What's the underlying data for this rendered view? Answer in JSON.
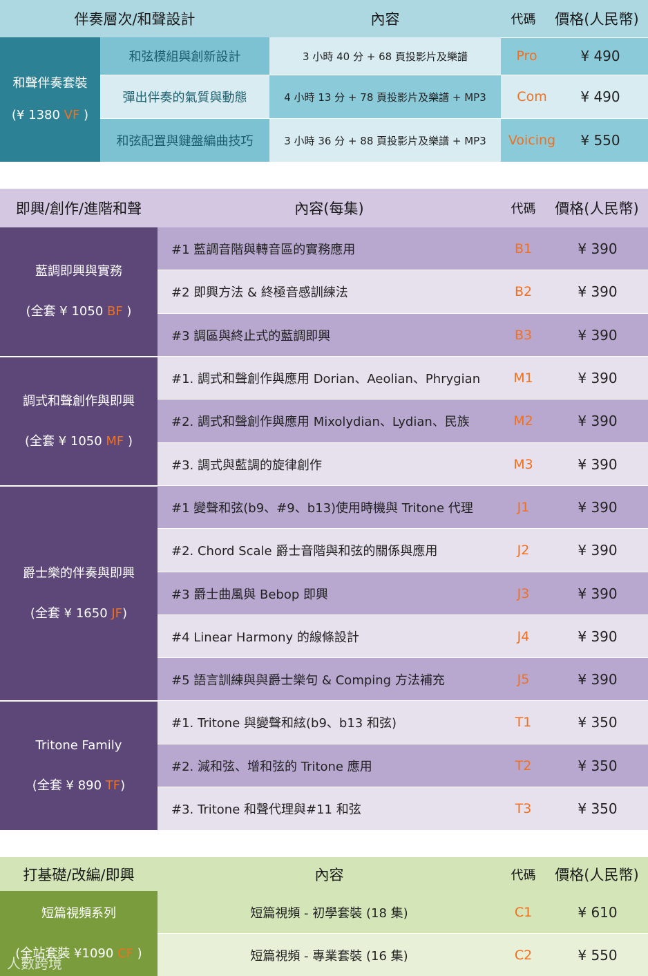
{
  "colors": {
    "sec1_header": "#aed8e1",
    "sec1_group": "#2c8294",
    "sec1_col1": "#7dc2d2",
    "sec1_row_light": "#d9ecf1",
    "sec1_row_mid": "#8bcad9",
    "sec2_header": "#d4c7e1",
    "sec2_group": "#5c4778",
    "sec2_row_dark": "#b8a8d0",
    "sec2_row_light": "#e7e1ee",
    "sec3_header": "#d3e4b7",
    "sec3_group": "#7a9c3c",
    "sec3_row_mid": "#d4e6b8",
    "sec3_row_light": "#e8f1d8",
    "code": "#f07020"
  },
  "sections": [
    {
      "header": {
        "title": "伴奏層次/和聲設計",
        "content": "內容",
        "code": "代碼",
        "price": "價格(人民幣)"
      },
      "groups": [
        {
          "name": "和聲伴奏套裝",
          "set_prefix": "(¥ 1380 ",
          "set_code": "VF",
          "set_suffix": " )",
          "rows": [
            {
              "title": "和弦模組與創新設計",
              "content": "3 小時 40 分 + 68 頁投影片及樂譜",
              "code": "Pro",
              "price": "¥ 490"
            },
            {
              "title": "彈出伴奏的氣質與動態",
              "content": "4 小時 13 分 + 78 頁投影片及樂譜 + MP3",
              "code": "Com",
              "price": "¥ 490"
            },
            {
              "title": "和弦配置與鍵盤編曲技巧",
              "content": "3 小時 36 分 + 88 頁投影片及樂譜 + MP3",
              "code": "Voicing",
              "price": "¥ 550"
            }
          ]
        }
      ]
    },
    {
      "header": {
        "title": "即興/創作/進階和聲",
        "content": "內容(每集)",
        "code": "代碼",
        "price": "價格(人民幣)"
      },
      "groups": [
        {
          "name": "藍調即興與實務",
          "set_prefix": "(全套 ¥ 1050 ",
          "set_code": "BF",
          "set_suffix": " )",
          "rows": [
            {
              "content": "#1  藍調音階與轉音區的實務應用",
              "code": "B1",
              "price": "¥ 390"
            },
            {
              "content": "#2  即興方法  &  終極音感訓練法",
              "code": "B2",
              "price": "¥ 390"
            },
            {
              "content": "#3  調區與終止式的藍調即興",
              "code": "B3",
              "price": "¥ 390"
            }
          ]
        },
        {
          "name": "調式和聲創作與即興",
          "set_prefix": "(全套 ¥ 1050 ",
          "set_code": "MF",
          "set_suffix": " )",
          "rows": [
            {
              "content": "#1.  調式和聲創作與應用  Dorian、Aeolian、Phrygian",
              "code": "M1",
              "price": "¥ 390"
            },
            {
              "content": "#2.  調式和聲創作與應用  Mixolydian、Lydian、民族",
              "code": "M2",
              "price": "¥ 390"
            },
            {
              "content": "#3.  調式與藍調的旋律創作",
              "code": "M3",
              "price": "¥ 390"
            }
          ]
        },
        {
          "name": "爵士樂的伴奏與即興",
          "set_prefix": "(全套 ¥ 1650 ",
          "set_code": "JF",
          "set_suffix": ")",
          "rows": [
            {
              "content": "#1  變聲和弦(b9、#9、b13)使用時機與 Tritone 代理",
              "code": "J1",
              "price": "¥ 390"
            },
            {
              "content": "#2. Chord Scale  爵士音階與和弦的關係與應用",
              "code": "J2",
              "price": "¥ 390"
            },
            {
              "content": "#3  爵士曲風與 Bebop 即興",
              "code": "J3",
              "price": "¥ 390"
            },
            {
              "content": "#4 Linear Harmony 的線條設計",
              "code": "J4",
              "price": "¥ 390"
            },
            {
              "content": "#5 語言訓練與與爵士樂句  &   Comping 方法補充",
              "code": "J5",
              "price": "¥ 390"
            }
          ]
        },
        {
          "name": "Tritone Family",
          "set_prefix": "(全套 ¥ 890 ",
          "set_code": "TF",
          "set_suffix": ")",
          "rows": [
            {
              "content": "#1. Tritone 與變聲和絃(b9、b13 和弦)",
              "code": "T1",
              "price": "¥ 350"
            },
            {
              "content": "#2.  減和弦、增和弦的 Tritone 應用",
              "code": "T2",
              "price": "¥ 350"
            },
            {
              "content": "#3. Tritone 和聲代理與#11 和弦",
              "code": "T3",
              "price": "¥ 350"
            }
          ]
        }
      ]
    },
    {
      "header": {
        "title": "打基礎/改編/即興",
        "content": "內容",
        "code": "代碼",
        "price": "價格(人民幣)"
      },
      "groups": [
        {
          "name": "短篇視頻系列",
          "set_prefix": "(全站套裝 ¥1090 ",
          "set_code": "CF",
          "set_suffix": " )",
          "rows": [
            {
              "content": "短篇視頻  -  初學套裝  (18 集)",
              "code": "C1",
              "price": "¥ 610"
            },
            {
              "content": "短篇視頻  -  專業套裝  (16 集)",
              "code": "C2",
              "price": "¥ 550"
            }
          ]
        }
      ]
    }
  ],
  "watermark": "人數跨境"
}
